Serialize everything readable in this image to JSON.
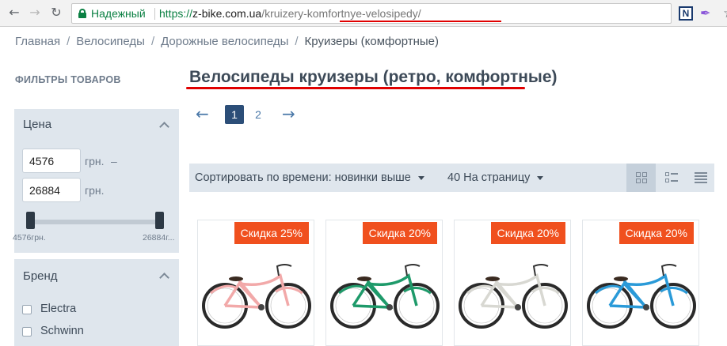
{
  "browser": {
    "secure_label": "Надежный",
    "url_scheme": "https://",
    "url_host": "z-bike.com.ua",
    "url_path": "/kruizery-komfortnye-velosipedy/",
    "back_icon": "arrow-left",
    "forward_icon": "arrow-right",
    "reload_icon": "reload",
    "bookmark_icon": "star",
    "extension_n_label": "N"
  },
  "breadcrumb": {
    "items": [
      "Главная",
      "Велосипеды",
      "Дорожные велосипеды"
    ],
    "current": "Круизеры (комфортные)",
    "separator": "/"
  },
  "sidebar": {
    "title": "ФИЛЬТРЫ ТОВАРОВ",
    "price": {
      "title": "Цена",
      "min_value": "4576",
      "max_value": "26884",
      "currency": "грн.",
      "dash": "–",
      "min_label": "4576грн.",
      "max_label": "26884г...",
      "range_min_fraction": 0,
      "range_max_fraction": 1
    },
    "brand": {
      "title": "Бренд",
      "options": [
        {
          "label": "Electra",
          "checked": false
        },
        {
          "label": "Schwinn",
          "checked": false
        }
      ]
    }
  },
  "main": {
    "title": "Велосипеды круизеры (ретро, комфортные)",
    "pagination": {
      "prev": "←",
      "next": "→",
      "pages": [
        "1",
        "2"
      ],
      "current": "1"
    },
    "toolbar": {
      "sort_label": "Сортировать по времени: новинки выше",
      "per_page_label": "40 На страницу",
      "views": [
        "grid-large",
        "grid-small",
        "list"
      ],
      "active_view": "grid-large"
    },
    "products": [
      {
        "discount": "Скидка 25%",
        "bike_color": "#f2a9a9",
        "tire_color": "#2a2a2a"
      },
      {
        "discount": "Скидка 20%",
        "bike_color": "#1e9a6a",
        "tire_color": "#2a2a2a"
      },
      {
        "discount": "Скидка 20%",
        "bike_color": "#d8d8d2",
        "tire_color": "#2a2a2a"
      },
      {
        "discount": "Скидка 20%",
        "bike_color": "#2a9ad8",
        "tire_color": "#2a2a2a"
      }
    ]
  },
  "colors": {
    "accent_dark": "#2c4e78",
    "discount": "#f0501e",
    "panel_bg": "#dfe6ed",
    "annotation_red": "#e00000",
    "secure_green": "#0b8043"
  }
}
